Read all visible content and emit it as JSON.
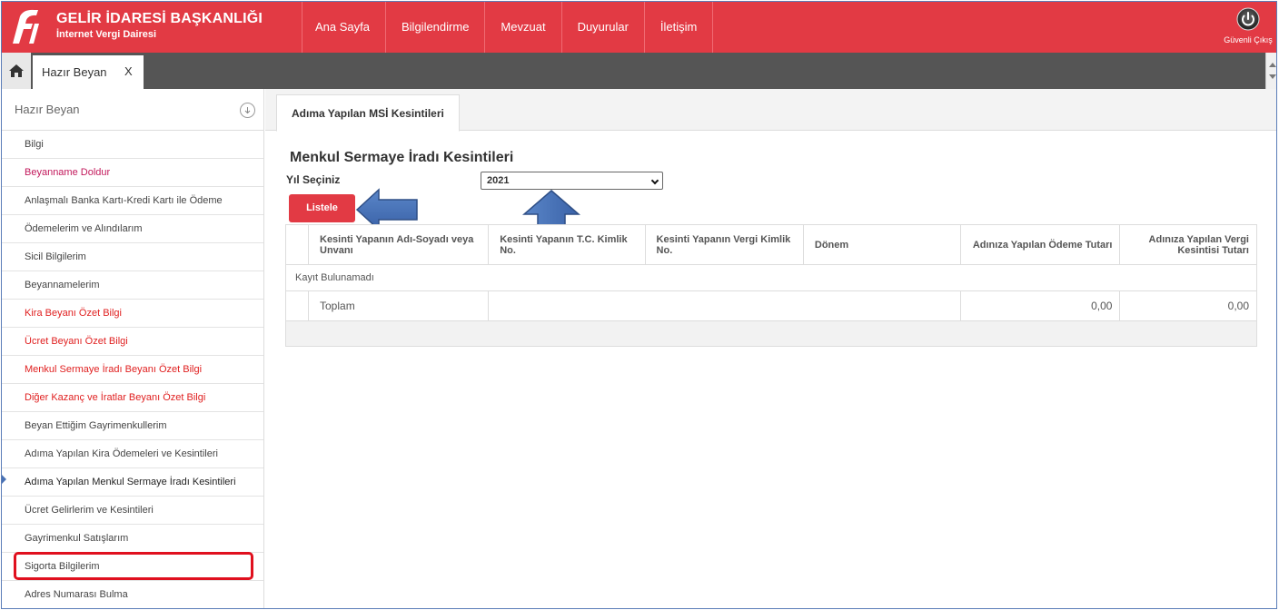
{
  "header": {
    "title": "GELİR İDARESİ BAŞKANLIĞI",
    "subtitle": "İnternet Vergi Dairesi",
    "nav": [
      "Ana Sayfa",
      "Bilgilendirme",
      "Mevzuat",
      "Duyurular",
      "İletişim"
    ],
    "logout_label": "Güvenli Çıkış",
    "accent_color": "#e23a44"
  },
  "tabbar": {
    "home_icon": "home-icon",
    "tab_label": "Hazır Beyan",
    "tab_close": "X"
  },
  "sidebar": {
    "title": "Hazır Beyan",
    "items": [
      {
        "label": "Bilgi"
      },
      {
        "label": "Beyanname Doldur"
      },
      {
        "label": "Anlaşmalı Banka Kartı-Kredi Kartı ile Ödeme"
      },
      {
        "label": "Ödemelerim ve Alındılarım"
      },
      {
        "label": "Sicil Bilgilerim"
      },
      {
        "label": "Beyannamelerim"
      },
      {
        "label": "Kira Beyanı Özet Bilgi"
      },
      {
        "label": "Ücret Beyanı Özet Bilgi"
      },
      {
        "label": "Menkul Sermaye İradı Beyanı Özet Bilgi"
      },
      {
        "label": "Diğer Kazanç ve İratlar Beyanı Özet Bilgi"
      },
      {
        "label": "Beyan Ettiğim Gayrimenkullerim"
      },
      {
        "label": "Adıma Yapılan Kira Ödemeleri ve Kesintileri"
      },
      {
        "label": "Adıma Yapılan Menkul Sermaye İradı Kesintileri"
      },
      {
        "label": "Ücret Gelirlerim ve Kesintileri"
      },
      {
        "label": "Gayrimenkul Satışlarım"
      },
      {
        "label": "Sigorta Bilgilerim"
      },
      {
        "label": "Adres Numarası Bulma"
      }
    ]
  },
  "main": {
    "tab_label": "Adıma Yapılan MSİ Kesintileri",
    "page_title": "Menkul Sermaye İradı Kesintileri",
    "year_label": "Yıl Seçiniz",
    "year_value": "2021",
    "list_button": "Listele",
    "table": {
      "columns": [
        "Kesinti Yapanın Adı-Soyadı veya Unvanı",
        "Kesinti Yapanın T.C. Kimlik No.",
        "Kesinti Yapanın Vergi Kimlik No.",
        "Dönem",
        "Adınıza Yapılan Ödeme Tutarı",
        "Adınıza Yapılan Vergi Kesintisi Tutarı"
      ],
      "empty_message": "Kayıt Bulunamadı",
      "total_label": "Toplam",
      "total_payment": "0,00",
      "total_tax": "0,00"
    }
  }
}
